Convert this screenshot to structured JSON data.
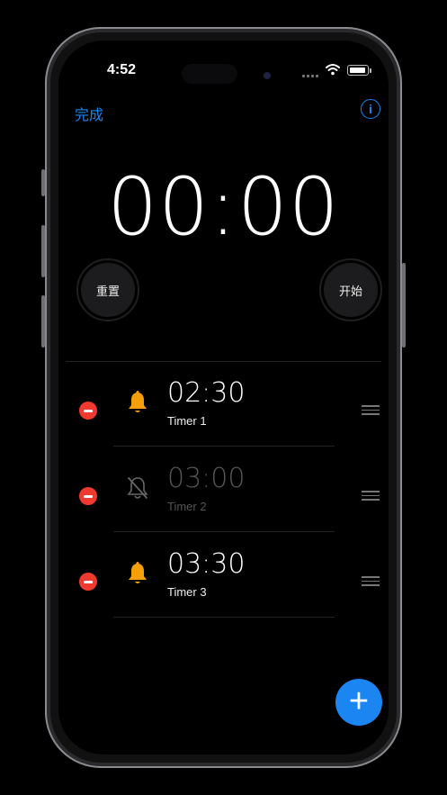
{
  "status": {
    "time": "4:52"
  },
  "nav": {
    "done_label": "完成",
    "info_label": "i"
  },
  "display": {
    "time": "00:00"
  },
  "controls": {
    "reset_label": "重置",
    "start_label": "开始"
  },
  "timers": [
    {
      "time": "02:30",
      "name": "Timer 1",
      "enabled": true
    },
    {
      "time": "03:00",
      "name": "Timer 2",
      "enabled": false
    },
    {
      "time": "03:30",
      "name": "Timer 3",
      "enabled": true
    }
  ],
  "fab": {
    "label": "+"
  },
  "colors": {
    "accent": "#1b86f2",
    "delete": "#f03a30",
    "bell": "#f5a00a"
  }
}
